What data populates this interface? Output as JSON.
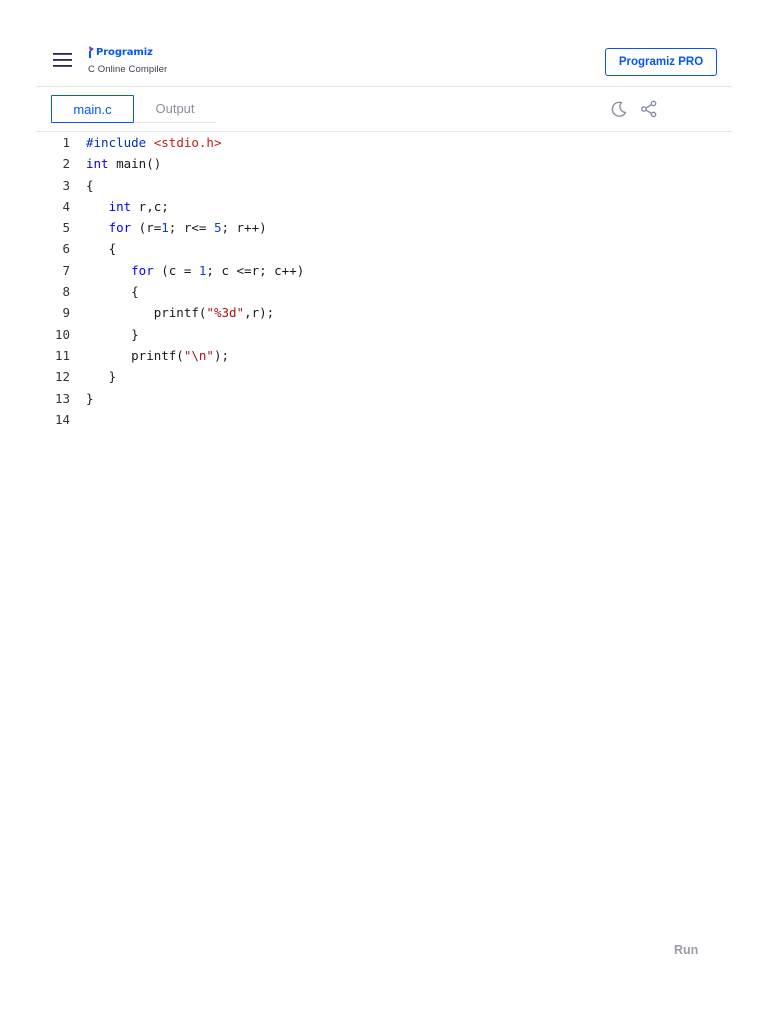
{
  "header": {
    "brand": "Programiz",
    "subtitle": "C Online Compiler",
    "pro_button": "Programiz PRO"
  },
  "tabs": {
    "main_label": "main.c",
    "output_label": "Output"
  },
  "icons": {
    "menu": "hamburger-menu-icon",
    "theme": "moon-icon",
    "share": "share-icon"
  },
  "colors": {
    "accent": "#0556f3",
    "keyword": "#0000ff",
    "string": "#a11111"
  },
  "code": {
    "lines": [
      {
        "n": "1",
        "text": "#include <stdio.h>"
      },
      {
        "n": "2",
        "text": "int main()"
      },
      {
        "n": "3",
        "text": "{"
      },
      {
        "n": "4",
        "text": "   int r,c;"
      },
      {
        "n": "5",
        "text": "   for (r=1; r<= 5; r++)"
      },
      {
        "n": "6",
        "text": "   {"
      },
      {
        "n": "7",
        "text": "      for (c = 1; c <=r; c++)"
      },
      {
        "n": "8",
        "text": "      {"
      },
      {
        "n": "9",
        "text": "         printf(\"%3d\",r);"
      },
      {
        "n": "10",
        "text": "      }"
      },
      {
        "n": "11",
        "text": "      printf(\"\\n\");"
      },
      {
        "n": "12",
        "text": "   }"
      },
      {
        "n": "13",
        "text": "}"
      },
      {
        "n": "14",
        "text": ""
      }
    ]
  },
  "run": {
    "label": "Run"
  }
}
